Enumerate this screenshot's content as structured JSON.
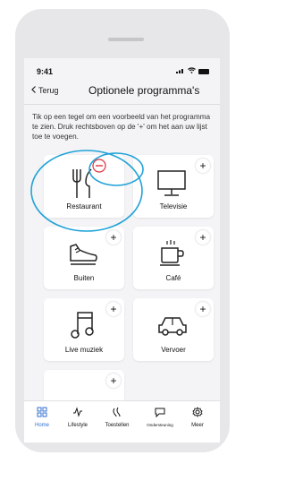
{
  "status": {
    "time": "9:41"
  },
  "nav": {
    "back_label": "Terug",
    "title": "Optionele programma's"
  },
  "description": "Tik op een tegel om een voorbeeld van het programma te zien. Druk rechtsboven op de '+' om het aan uw lijst toe te voegen.",
  "tiles": [
    {
      "label": "Restaurant",
      "icon": "restaurant-icon",
      "action": "remove"
    },
    {
      "label": "Televisie",
      "icon": "tv-icon",
      "action": "add"
    },
    {
      "label": "Buiten",
      "icon": "shoe-icon",
      "action": "add"
    },
    {
      "label": "Café",
      "icon": "coffee-cup-icon",
      "action": "add"
    },
    {
      "label": "Live muziek",
      "icon": "music-note-icon",
      "action": "add"
    },
    {
      "label": "Vervoer",
      "icon": "car-icon",
      "action": "add"
    },
    {
      "label": "",
      "icon": "",
      "action": "add"
    }
  ],
  "tabbar": {
    "items": [
      {
        "label": "Home",
        "icon": "grid-icon",
        "active": true
      },
      {
        "label": "Lifestyle",
        "icon": "activity-icon",
        "active": false
      },
      {
        "label": "Toestellen",
        "icon": "hearing-aids-icon",
        "active": false
      },
      {
        "label": "Ondersteuning",
        "icon": "chat-icon",
        "active": false
      },
      {
        "label": "Meer",
        "icon": "gear-icon",
        "active": false
      }
    ]
  },
  "colors": {
    "accent": "#2f6fd0",
    "highlight": "#22a3d8",
    "remove": "#e0303a"
  }
}
